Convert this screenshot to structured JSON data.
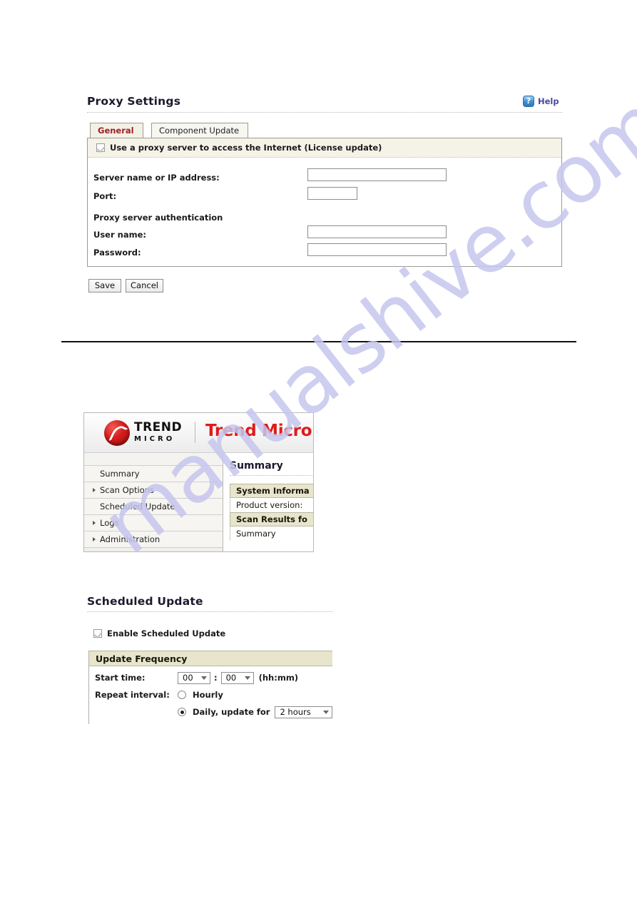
{
  "proxy_settings": {
    "title": "Proxy Settings",
    "help": {
      "label": "Help",
      "icon": "help-question-icon"
    },
    "tabs": [
      {
        "label": "General",
        "active": true
      },
      {
        "label": "Component Update",
        "active": false
      }
    ],
    "enable_checkbox": {
      "label": "Use a proxy server to access the Internet (License update)",
      "checked": true
    },
    "fields": [
      {
        "label": "Server name or IP address:",
        "value": ""
      },
      {
        "label": "Port:",
        "value": ""
      }
    ],
    "auth_heading": "Proxy server authentication",
    "auth_fields": [
      {
        "label": "User name:",
        "value": ""
      },
      {
        "label": "Password:",
        "value": ""
      }
    ],
    "buttons": {
      "save": "Save",
      "cancel": "Cancel"
    }
  },
  "console": {
    "brand": {
      "logo_line1": "TREND",
      "logo_line2": "MICRO",
      "product": "Trend Micro"
    },
    "nav_items": [
      {
        "label": "Summary",
        "expandable": false
      },
      {
        "label": "Scan Options",
        "expandable": true
      },
      {
        "label": "Scheduled Update",
        "expandable": false
      },
      {
        "label": "Logs",
        "expandable": true
      },
      {
        "label": "Administration",
        "expandable": true
      }
    ],
    "main": {
      "title": "Summary",
      "rows": [
        {
          "type": "header",
          "label": "System Informa"
        },
        {
          "type": "cell",
          "label": "Product version:"
        },
        {
          "type": "header",
          "label": "Scan Results fo"
        },
        {
          "type": "cell",
          "label": "Summary"
        }
      ]
    }
  },
  "scheduled_update": {
    "title": "Scheduled Update",
    "enable_checkbox": {
      "label": "Enable Scheduled Update",
      "checked": true
    },
    "panel_header": "Update Frequency",
    "start_time": {
      "label": "Start time:",
      "hours": "00",
      "separator": ":",
      "minutes": "00",
      "format_hint": "(hh:mm)"
    },
    "repeat_interval": {
      "label": "Repeat interval:",
      "options": [
        {
          "label": "Hourly",
          "selected": false
        },
        {
          "label": "Daily, update for",
          "selected": true,
          "duration": "2 hours"
        }
      ]
    }
  },
  "watermark": {
    "text": "manualshive.com"
  },
  "colors": {
    "brand_red": "#e01b1b",
    "tab_active_text": "#9d1f1f",
    "panel_header_beige": "#e8e5cc",
    "help_text": "#4a49a0",
    "watermark": "#c6c6ee"
  }
}
